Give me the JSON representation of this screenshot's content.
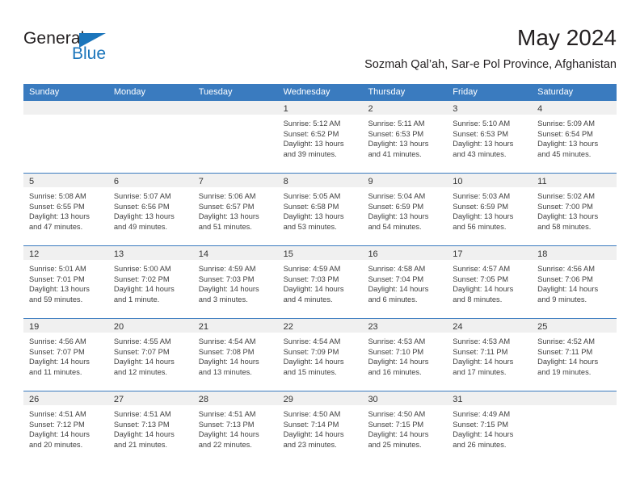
{
  "logo": {
    "word1": "General",
    "word2": "Blue",
    "accent_color": "#1b75bb"
  },
  "header": {
    "title": "May 2024",
    "subtitle": "Sozmah Qal’ah, Sar-e Pol Province, Afghanistan"
  },
  "calendar": {
    "header_bg": "#3a7bbf",
    "daynum_bg": "#f0f0f0",
    "weekdays": [
      "Sunday",
      "Monday",
      "Tuesday",
      "Wednesday",
      "Thursday",
      "Friday",
      "Saturday"
    ],
    "weeks": [
      [
        {
          "day": "",
          "lines": []
        },
        {
          "day": "",
          "lines": []
        },
        {
          "day": "",
          "lines": []
        },
        {
          "day": "1",
          "lines": [
            "Sunrise: 5:12 AM",
            "Sunset: 6:52 PM",
            "Daylight: 13 hours",
            "and 39 minutes."
          ]
        },
        {
          "day": "2",
          "lines": [
            "Sunrise: 5:11 AM",
            "Sunset: 6:53 PM",
            "Daylight: 13 hours",
            "and 41 minutes."
          ]
        },
        {
          "day": "3",
          "lines": [
            "Sunrise: 5:10 AM",
            "Sunset: 6:53 PM",
            "Daylight: 13 hours",
            "and 43 minutes."
          ]
        },
        {
          "day": "4",
          "lines": [
            "Sunrise: 5:09 AM",
            "Sunset: 6:54 PM",
            "Daylight: 13 hours",
            "and 45 minutes."
          ]
        }
      ],
      [
        {
          "day": "5",
          "lines": [
            "Sunrise: 5:08 AM",
            "Sunset: 6:55 PM",
            "Daylight: 13 hours",
            "and 47 minutes."
          ]
        },
        {
          "day": "6",
          "lines": [
            "Sunrise: 5:07 AM",
            "Sunset: 6:56 PM",
            "Daylight: 13 hours",
            "and 49 minutes."
          ]
        },
        {
          "day": "7",
          "lines": [
            "Sunrise: 5:06 AM",
            "Sunset: 6:57 PM",
            "Daylight: 13 hours",
            "and 51 minutes."
          ]
        },
        {
          "day": "8",
          "lines": [
            "Sunrise: 5:05 AM",
            "Sunset: 6:58 PM",
            "Daylight: 13 hours",
            "and 53 minutes."
          ]
        },
        {
          "day": "9",
          "lines": [
            "Sunrise: 5:04 AM",
            "Sunset: 6:59 PM",
            "Daylight: 13 hours",
            "and 54 minutes."
          ]
        },
        {
          "day": "10",
          "lines": [
            "Sunrise: 5:03 AM",
            "Sunset: 6:59 PM",
            "Daylight: 13 hours",
            "and 56 minutes."
          ]
        },
        {
          "day": "11",
          "lines": [
            "Sunrise: 5:02 AM",
            "Sunset: 7:00 PM",
            "Daylight: 13 hours",
            "and 58 minutes."
          ]
        }
      ],
      [
        {
          "day": "12",
          "lines": [
            "Sunrise: 5:01 AM",
            "Sunset: 7:01 PM",
            "Daylight: 13 hours",
            "and 59 minutes."
          ]
        },
        {
          "day": "13",
          "lines": [
            "Sunrise: 5:00 AM",
            "Sunset: 7:02 PM",
            "Daylight: 14 hours",
            "and 1 minute."
          ]
        },
        {
          "day": "14",
          "lines": [
            "Sunrise: 4:59 AM",
            "Sunset: 7:03 PM",
            "Daylight: 14 hours",
            "and 3 minutes."
          ]
        },
        {
          "day": "15",
          "lines": [
            "Sunrise: 4:59 AM",
            "Sunset: 7:03 PM",
            "Daylight: 14 hours",
            "and 4 minutes."
          ]
        },
        {
          "day": "16",
          "lines": [
            "Sunrise: 4:58 AM",
            "Sunset: 7:04 PM",
            "Daylight: 14 hours",
            "and 6 minutes."
          ]
        },
        {
          "day": "17",
          "lines": [
            "Sunrise: 4:57 AM",
            "Sunset: 7:05 PM",
            "Daylight: 14 hours",
            "and 8 minutes."
          ]
        },
        {
          "day": "18",
          "lines": [
            "Sunrise: 4:56 AM",
            "Sunset: 7:06 PM",
            "Daylight: 14 hours",
            "and 9 minutes."
          ]
        }
      ],
      [
        {
          "day": "19",
          "lines": [
            "Sunrise: 4:56 AM",
            "Sunset: 7:07 PM",
            "Daylight: 14 hours",
            "and 11 minutes."
          ]
        },
        {
          "day": "20",
          "lines": [
            "Sunrise: 4:55 AM",
            "Sunset: 7:07 PM",
            "Daylight: 14 hours",
            "and 12 minutes."
          ]
        },
        {
          "day": "21",
          "lines": [
            "Sunrise: 4:54 AM",
            "Sunset: 7:08 PM",
            "Daylight: 14 hours",
            "and 13 minutes."
          ]
        },
        {
          "day": "22",
          "lines": [
            "Sunrise: 4:54 AM",
            "Sunset: 7:09 PM",
            "Daylight: 14 hours",
            "and 15 minutes."
          ]
        },
        {
          "day": "23",
          "lines": [
            "Sunrise: 4:53 AM",
            "Sunset: 7:10 PM",
            "Daylight: 14 hours",
            "and 16 minutes."
          ]
        },
        {
          "day": "24",
          "lines": [
            "Sunrise: 4:53 AM",
            "Sunset: 7:11 PM",
            "Daylight: 14 hours",
            "and 17 minutes."
          ]
        },
        {
          "day": "25",
          "lines": [
            "Sunrise: 4:52 AM",
            "Sunset: 7:11 PM",
            "Daylight: 14 hours",
            "and 19 minutes."
          ]
        }
      ],
      [
        {
          "day": "26",
          "lines": [
            "Sunrise: 4:51 AM",
            "Sunset: 7:12 PM",
            "Daylight: 14 hours",
            "and 20 minutes."
          ]
        },
        {
          "day": "27",
          "lines": [
            "Sunrise: 4:51 AM",
            "Sunset: 7:13 PM",
            "Daylight: 14 hours",
            "and 21 minutes."
          ]
        },
        {
          "day": "28",
          "lines": [
            "Sunrise: 4:51 AM",
            "Sunset: 7:13 PM",
            "Daylight: 14 hours",
            "and 22 minutes."
          ]
        },
        {
          "day": "29",
          "lines": [
            "Sunrise: 4:50 AM",
            "Sunset: 7:14 PM",
            "Daylight: 14 hours",
            "and 23 minutes."
          ]
        },
        {
          "day": "30",
          "lines": [
            "Sunrise: 4:50 AM",
            "Sunset: 7:15 PM",
            "Daylight: 14 hours",
            "and 25 minutes."
          ]
        },
        {
          "day": "31",
          "lines": [
            "Sunrise: 4:49 AM",
            "Sunset: 7:15 PM",
            "Daylight: 14 hours",
            "and 26 minutes."
          ]
        },
        {
          "day": "",
          "lines": []
        }
      ]
    ]
  }
}
